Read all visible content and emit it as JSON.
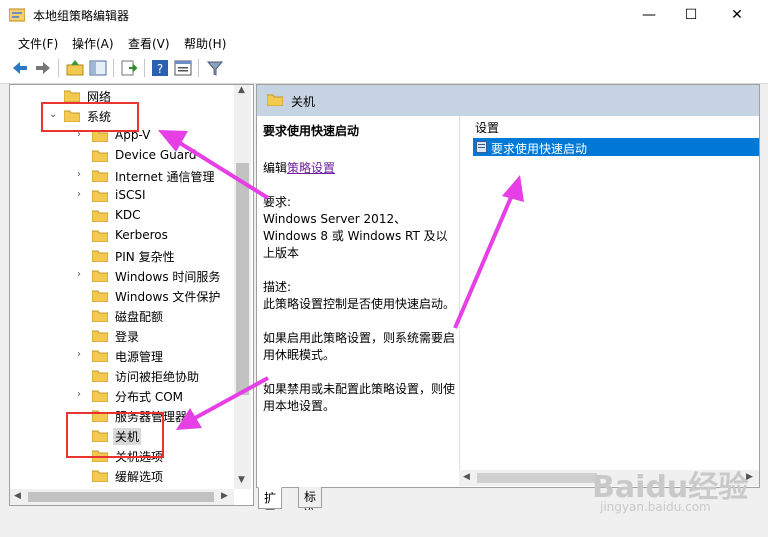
{
  "window": {
    "title": "本地组策略编辑器",
    "controls": {
      "minimize": "—",
      "maximize": "☐",
      "close": "✕"
    }
  },
  "menu": [
    "文件(F)",
    "操作(A)",
    "查看(V)",
    "帮助(H)"
  ],
  "toolbar": {
    "icons": [
      "back-icon",
      "forward-icon",
      "up-folder-icon",
      "show-hide-tree-icon",
      "export-list-icon",
      "help-icon",
      "properties-icon",
      "filter-icon"
    ]
  },
  "tree": {
    "items": [
      {
        "label": "网络",
        "chevron": "",
        "selected": false
      },
      {
        "label": "系统",
        "chevron": "⌄",
        "selected": false
      },
      {
        "label": "App-V",
        "chevron": "›",
        "selected": false
      },
      {
        "label": "Device Guard",
        "chevron": "",
        "selected": false
      },
      {
        "label": "Internet 通信管理",
        "chevron": "›",
        "selected": false
      },
      {
        "label": "iSCSI",
        "chevron": "›",
        "selected": false
      },
      {
        "label": "KDC",
        "chevron": "",
        "selected": false
      },
      {
        "label": "Kerberos",
        "chevron": "",
        "selected": false
      },
      {
        "label": "PIN 复杂性",
        "chevron": "",
        "selected": false
      },
      {
        "label": "Windows 时间服务",
        "chevron": "›",
        "selected": false
      },
      {
        "label": "Windows 文件保护",
        "chevron": "",
        "selected": false
      },
      {
        "label": "磁盘配额",
        "chevron": "",
        "selected": false
      },
      {
        "label": "登录",
        "chevron": "",
        "selected": false
      },
      {
        "label": "电源管理",
        "chevron": "›",
        "selected": false
      },
      {
        "label": "访问被拒绝协助",
        "chevron": "",
        "selected": false
      },
      {
        "label": "分布式 COM",
        "chevron": "›",
        "selected": false
      },
      {
        "label": "服务器管理器",
        "chevron": "",
        "selected": false
      },
      {
        "label": "关机",
        "chevron": "",
        "selected": true
      },
      {
        "label": "关机选项",
        "chevron": "",
        "selected": false
      },
      {
        "label": "缓解选项",
        "chevron": "",
        "selected": false
      }
    ]
  },
  "right_pane": {
    "header_title": "关机",
    "description": {
      "heading": "要求使用快速启动",
      "edit_prefix": "编辑",
      "edit_link": "策略设置",
      "requirements_label": "要求:",
      "requirements_text": "Windows Server 2012、Windows 8 或 Windows RT 及以上版本",
      "description_label": "描述:",
      "description_text": "此策略设置控制是否使用快速启动。",
      "enabled_text": "如果启用此策略设置，则系统需要启用休眠模式。",
      "disabled_text": "如果禁用或未配置此策略设置，则使用本地设置。"
    },
    "settings_header": "设置",
    "settings_items": [
      "要求使用快速启动"
    ]
  },
  "tabs": [
    "扩展",
    "标准"
  ],
  "watermark": {
    "brand": "Baidu经验",
    "url": "jingyan.baidu.com"
  },
  "colors": {
    "annotation_red": "#e8352f",
    "annotation_arrow": "#e63fe6",
    "selection_blue": "#0078d7",
    "header_blue": "#c6d3e3"
  }
}
